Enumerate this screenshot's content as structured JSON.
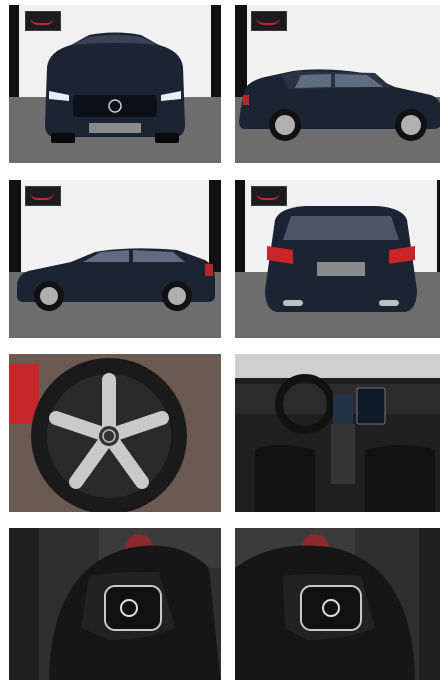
{
  "gallery": {
    "photos": [
      {
        "view": "front",
        "car_color": "#1c2333"
      },
      {
        "view": "side-right",
        "car_color": "#1c2333"
      },
      {
        "view": "side-left",
        "car_color": "#1c2333"
      },
      {
        "view": "rear",
        "car_color": "#1c2333"
      },
      {
        "view": "wheel-detail",
        "accent": "#c9c9c9"
      },
      {
        "view": "interior-dashboard",
        "accent": "#2b2b2b"
      },
      {
        "view": "steering-wheel-left-controls",
        "accent": "#1a1a1a"
      },
      {
        "view": "steering-wheel-right-controls",
        "accent": "#1a1a1a"
      }
    ],
    "colors": {
      "wall": "#f1f1f1",
      "floor": "#6d6d6d",
      "pillar": "#111111",
      "brand_badge_red": "#c8262b"
    }
  }
}
